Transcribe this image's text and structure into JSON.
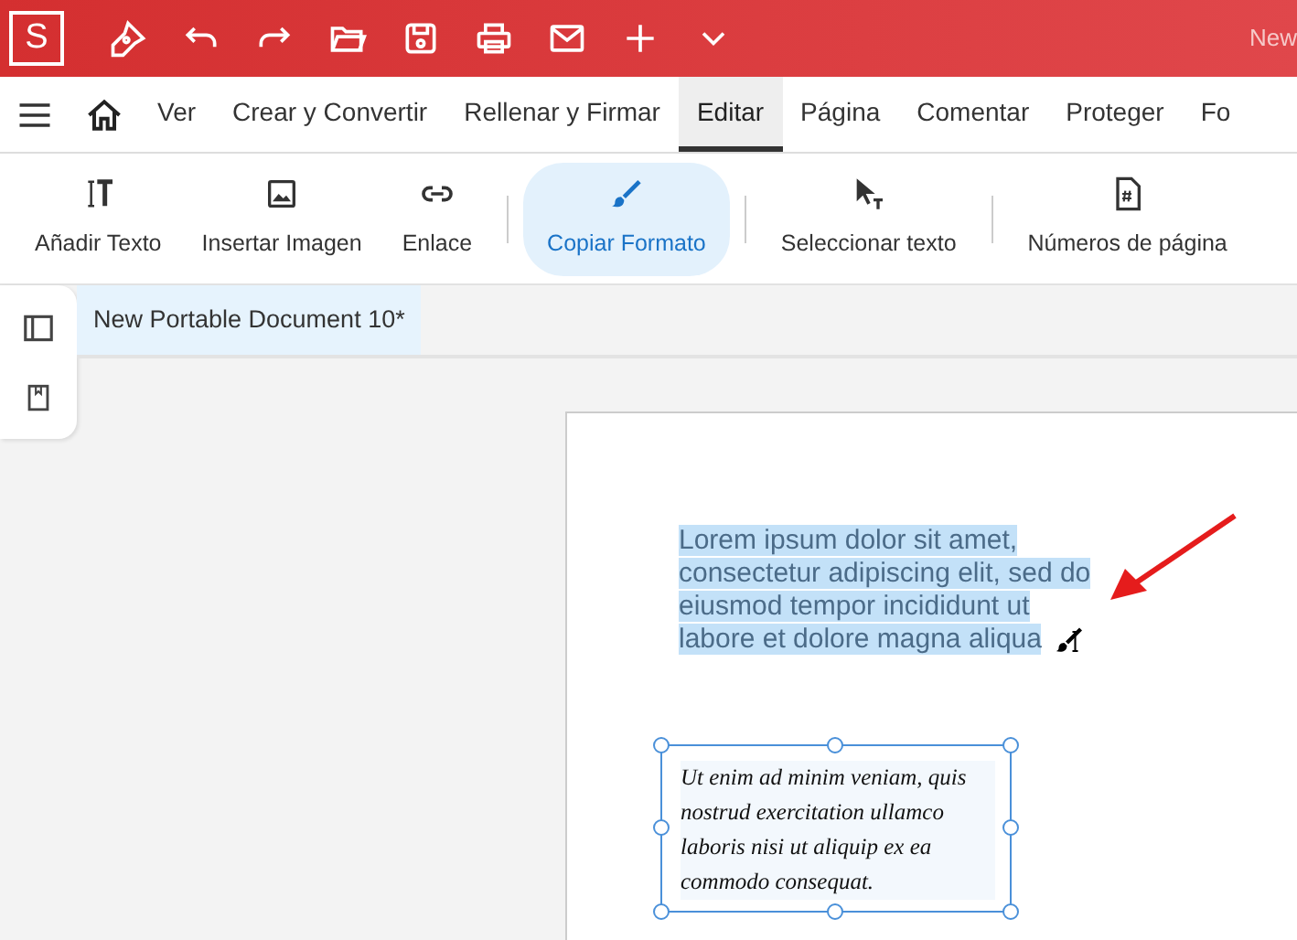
{
  "title_bar": {
    "logo": "S",
    "title": "New"
  },
  "menu_tabs": [
    {
      "label": "Ver",
      "selected": false
    },
    {
      "label": "Crear y Convertir",
      "selected": false
    },
    {
      "label": "Rellenar y Firmar",
      "selected": false
    },
    {
      "label": "Editar",
      "selected": true
    },
    {
      "label": "Página",
      "selected": false
    },
    {
      "label": "Comentar",
      "selected": false
    },
    {
      "label": "Proteger",
      "selected": false
    },
    {
      "label": "Fo",
      "selected": false
    }
  ],
  "tool_groups": [
    [
      {
        "kind": "text",
        "label": "Añadir Texto",
        "selected": false
      },
      {
        "kind": "image",
        "label": "Insertar Imagen",
        "selected": false
      },
      {
        "kind": "link",
        "label": "Enlace",
        "selected": false
      }
    ],
    [
      {
        "kind": "brush",
        "label": "Copiar Formato",
        "selected": true
      }
    ],
    [
      {
        "kind": "select",
        "label": "Seleccionar texto",
        "selected": false
      }
    ],
    [
      {
        "kind": "pagenum",
        "label": "Números de página",
        "selected": false
      }
    ]
  ],
  "document_tab": {
    "title": "New Portable Document 10*",
    "selected": true
  },
  "page": {
    "paragraph": "Lorem ipsum dolor sit amet, consectetur adipiscing elit, sed do eiusmod tempor incididunt ut labore et dolore magna aliqua",
    "text_box": "Ut enim ad minim veniam, quis nostrud exercitation ullamco laboris nisi ut aliquip ex ea commodo consequat."
  }
}
